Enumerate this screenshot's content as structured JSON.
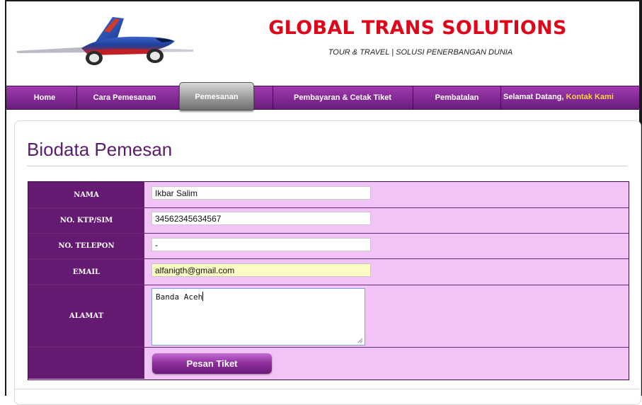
{
  "header": {
    "title": "GLOBAL TRANS SOLUTIONS",
    "tagline": "TOUR & TRAVEL | SOLUSI PENERBANGAN DUNIA",
    "logo_icon": "airplane-icon"
  },
  "nav": {
    "items": [
      {
        "label": "Home"
      },
      {
        "label": "Cara Pemesanan"
      },
      {
        "label": "Pemesanan",
        "active": true
      },
      {
        "label": "Pembayaran & Cetak Tiket"
      },
      {
        "label": "Pembatalan"
      }
    ],
    "welcome": "Selamat Datang,",
    "contact": "Kontak Kami"
  },
  "page": {
    "title": "Biodata Pemesan"
  },
  "form": {
    "nama": {
      "label": "NAMA",
      "value": "Ikbar Salim"
    },
    "ktp": {
      "label": "NO. KTP/SIM",
      "value": "34562345634567"
    },
    "telepon": {
      "label": "NO. TELEPON",
      "value": "-"
    },
    "email": {
      "label": "EMAIL",
      "value": "alfanigth@gmail.com"
    },
    "alamat": {
      "label": "ALAMAT",
      "value": "Banda Aceh"
    },
    "submit_label": "Pesan Tiket"
  },
  "colors": {
    "brand_red": "#e0061a",
    "nav_purple": "#6a1d7c",
    "label_purple": "#641a70",
    "field_pink": "#f2c3f7",
    "accent_yellow": "#ffd23f"
  }
}
